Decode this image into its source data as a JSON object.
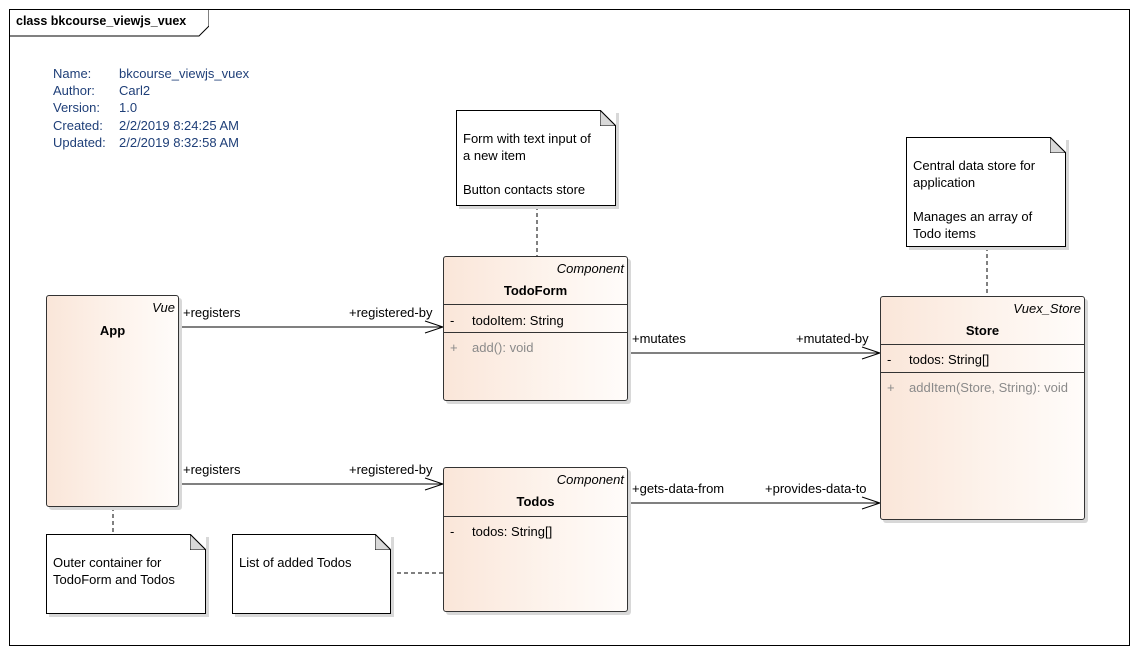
{
  "frame": {
    "title": "class bkcourse_viewjs_vuex"
  },
  "metadata": [
    {
      "key": "Name:",
      "value": "bkcourse_viewjs_vuex"
    },
    {
      "key": "Author:",
      "value": "Carl2"
    },
    {
      "key": "Version:",
      "value": "1.0"
    },
    {
      "key": "Created:",
      "value": "2/2/2019 8:24:25 AM"
    },
    {
      "key": "Updated:",
      "value": "2/2/2019 8:32:58 AM"
    }
  ],
  "classes": {
    "app": {
      "stereotype": "Vue",
      "name": "App"
    },
    "todoform": {
      "stereotype": "Component",
      "name": "TodoForm",
      "attributes": [
        {
          "visibility": "-",
          "text": "todoItem: String"
        }
      ],
      "operations": [
        {
          "visibility": "+",
          "text": "add(): void"
        }
      ]
    },
    "todos": {
      "stereotype": "Component",
      "name": "Todos",
      "attributes": [
        {
          "visibility": "-",
          "text": "todos: String[]"
        }
      ]
    },
    "store": {
      "stereotype": "Vuex_Store",
      "name": "Store",
      "attributes": [
        {
          "visibility": "-",
          "text": "todos: String[]"
        }
      ],
      "operations": [
        {
          "visibility": "+",
          "text": "addItem(Store, String): void"
        }
      ]
    }
  },
  "notes": {
    "todoform": [
      "Form with text input of",
      "a new item",
      "",
      "Button contacts store"
    ],
    "store": [
      "Central data store for",
      "application",
      "",
      "Manages an array of",
      "Todo items"
    ],
    "app": [
      "Outer container for",
      "TodoForm and Todos"
    ],
    "todos": [
      "List of added Todos"
    ]
  },
  "associations": [
    {
      "source_role": "+registers",
      "target_role": "+registered-by"
    },
    {
      "source_role": "+registers",
      "target_role": "+registered-by"
    },
    {
      "source_role": "+mutates",
      "target_role": "+mutated-by"
    },
    {
      "source_role": "+gets-data-from",
      "target_role": "+provides-data-to"
    }
  ]
}
